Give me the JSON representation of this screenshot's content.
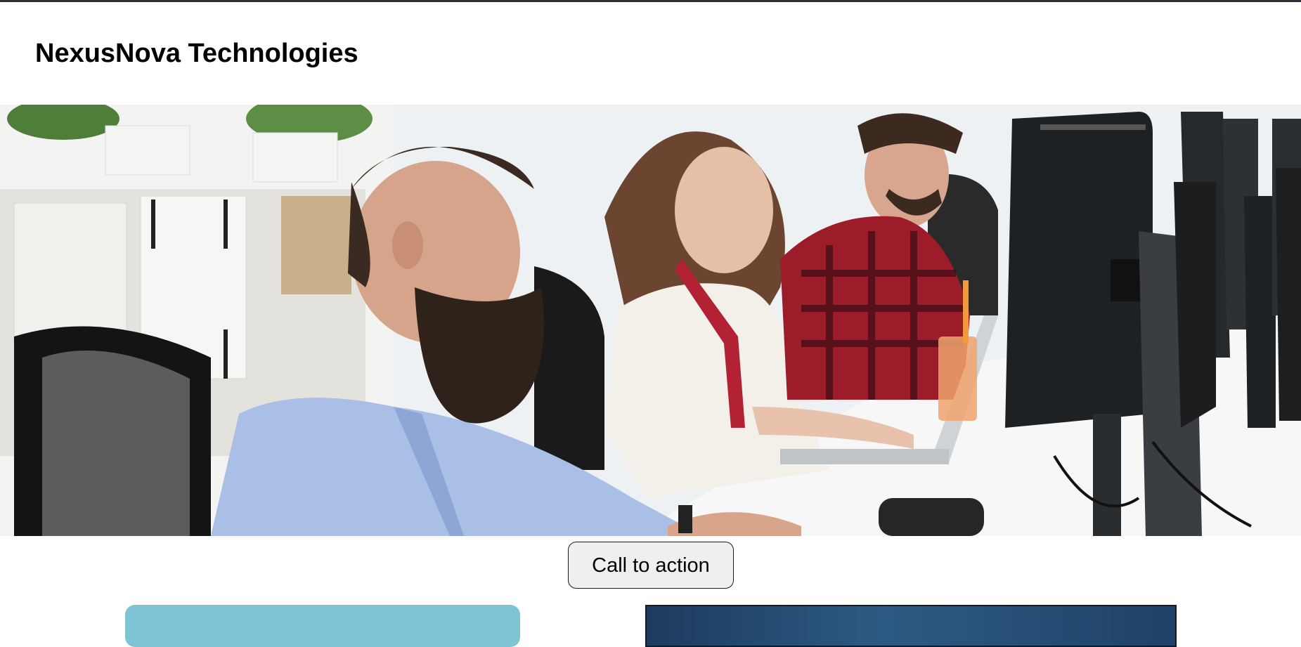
{
  "site": {
    "title": "NexusNova Technologies"
  },
  "hero": {
    "image": "office-workers-at-computers-photo"
  },
  "cta": {
    "label": "Call to action"
  },
  "colors": {
    "top_rule": "#2b3336",
    "card_left": "#7ec4d4",
    "card_right": "#1d3b5e",
    "button_bg": "#efefef"
  }
}
